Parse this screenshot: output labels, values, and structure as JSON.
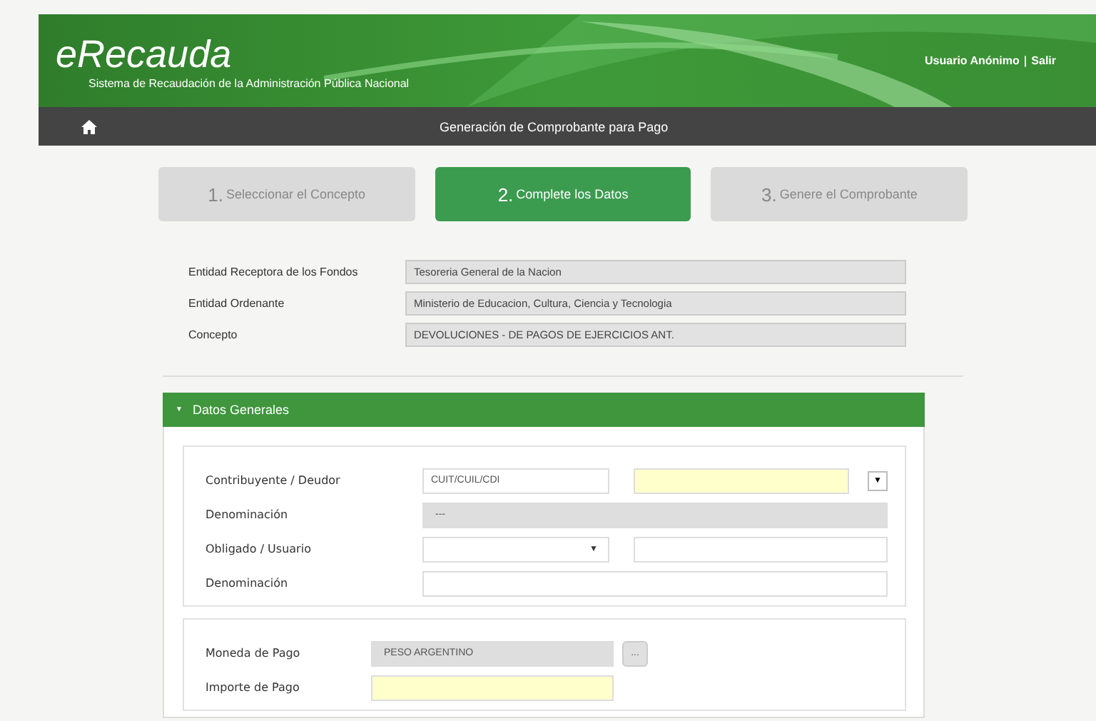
{
  "header": {
    "logo": "eRecauda",
    "subtitle": "Sistema de Recaudación de la Administración Pública Nacional",
    "user": "Usuario Anónimo",
    "separator": "|",
    "logout": "Salir"
  },
  "navbar": {
    "title": "Generación de Comprobante para Pago"
  },
  "steps": [
    {
      "number": "1.",
      "label": "Seleccionar el Concepto",
      "selected": false
    },
    {
      "number": "2.",
      "label": "Complete los Datos",
      "selected": true
    },
    {
      "number": "3.",
      "label": "Genere el Comprobante",
      "selected": false
    }
  ],
  "info": [
    {
      "label": "Entidad Receptora de los Fondos",
      "value": "Tesoreria General de la Nacion"
    },
    {
      "label": "Entidad Ordenante",
      "value": "Ministerio de Educacion, Cultura,  Ciencia y Tecnologia"
    },
    {
      "label": "Concepto",
      "value": "DEVOLUCIONES - DE PAGOS DE EJERCICIOS ANT."
    }
  ],
  "section": {
    "title": "Datos Generales",
    "expanded": true,
    "toggle": "▼"
  },
  "groups": [
    {
      "rows": [
        {
          "label": "Contribuyente / Deudor",
          "fields": [
            {
              "kind": "text",
              "placeholder": "CUIT/CUIL/CDI",
              "required": false
            },
            {
              "kind": "text",
              "required": true
            },
            {
              "kind": "dropdown",
              "text": "▼"
            }
          ]
        },
        {
          "label": "Denominación",
          "fields": [
            {
              "kind": "readonly",
              "value": "---"
            }
          ]
        },
        {
          "label": "Obligado / Usuario",
          "fields": [
            {
              "kind": "select",
              "arrow": "▼"
            },
            {
              "kind": "text",
              "required": false
            }
          ]
        },
        {
          "label": "Denominación",
          "fields": [
            {
              "kind": "text",
              "required": false
            }
          ]
        }
      ]
    },
    {
      "rows": [
        {
          "label": "Moneda de Pago",
          "fields": [
            {
              "kind": "readonly",
              "value": "PESO ARGENTINO"
            },
            {
              "kind": "button",
              "text": "..."
            }
          ]
        },
        {
          "label": "Importe de Pago",
          "fields": [
            {
              "kind": "text",
              "required": true
            }
          ]
        }
      ]
    }
  ]
}
